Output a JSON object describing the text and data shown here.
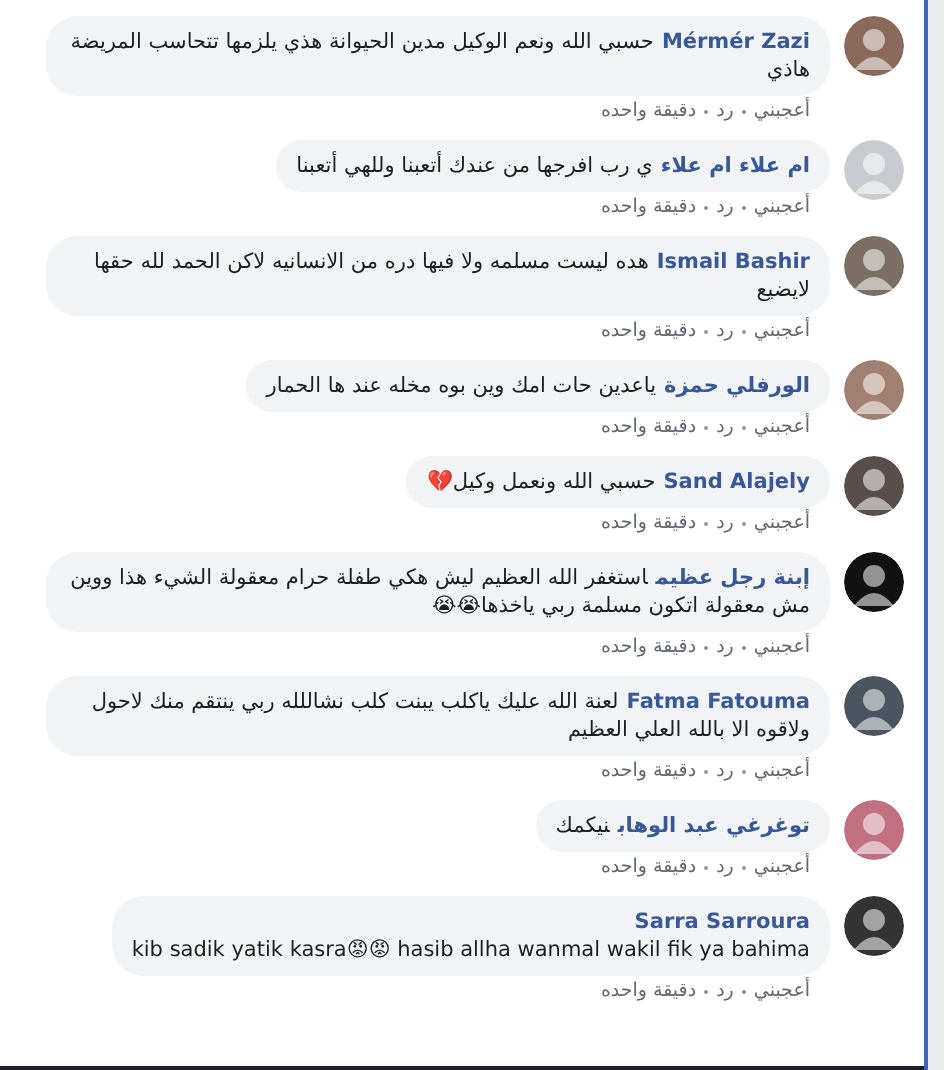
{
  "comments": [
    {
      "kind": "inline",
      "author": "Mérmér Zazi",
      "text": "حسبي الله ونعم الوكيل مدين الحيوانة هذي يلزمها تتحاسب المريضة هاذي",
      "like": "أعجبني",
      "reply": "رد",
      "time": "دقيقة واحده"
    },
    {
      "kind": "inline",
      "author": "ام علاء ام علاء",
      "text": "ي رب افرجها من عندك أتعبنا وللهي أتعبنا",
      "like": "أعجبني",
      "reply": "رد",
      "time": "دقيقة واحده"
    },
    {
      "kind": "inline",
      "author": "Ismail Bashir",
      "text": "هده ليست مسلمه ولا فيها دره من الانسانيه لاكن الحمد لله حقها لايضيع",
      "like": "أعجبني",
      "reply": "رد",
      "time": "دقيقة واحده"
    },
    {
      "kind": "inline",
      "author": "الورفلي حمزة",
      "text": "ياعدين حات امك وين بوه مخله عند ها الحمار",
      "like": "أعجبني",
      "reply": "رد",
      "time": "دقيقة واحده"
    },
    {
      "kind": "inline",
      "author": "Sand Alajely",
      "text": "حسبي الله ونعمل وكيل💔",
      "like": "أعجبني",
      "reply": "رد",
      "time": "دقيقة واحده"
    },
    {
      "kind": "inline",
      "author": "إبنة رجل عظيم",
      "text": "استغفر الله العظيم ليش هكي طفلة حرام معقولة الشيء هذا ووين مش معقولة اتكون مسلمة ربي ياخذها😭😭",
      "like": "أعجبني",
      "reply": "رد",
      "time": "دقيقة واحده"
    },
    {
      "kind": "inline",
      "author": "Fatma Fatouma",
      "text": "لعنة الله عليك ياكلب يبنت كلب نشاللله ربي ينتقم منك لاحول ولاقوه الا بالله العلي العظيم",
      "like": "أعجبني",
      "reply": "رد",
      "time": "دقيقة واحده"
    },
    {
      "kind": "inline",
      "author": "توغرغي عبد الوهاب",
      "text": "نيكمك",
      "like": "أعجبني",
      "reply": "رد",
      "time": "دقيقة واحده"
    },
    {
      "kind": "stacked",
      "author": "Sarra Sarroura",
      "text": "kib sadik yatik kasra😡😡  hasib allha wanmal wakil fik ya bahima",
      "like": "أعجبني",
      "reply": "رد",
      "time": "دقيقة واحده"
    }
  ]
}
